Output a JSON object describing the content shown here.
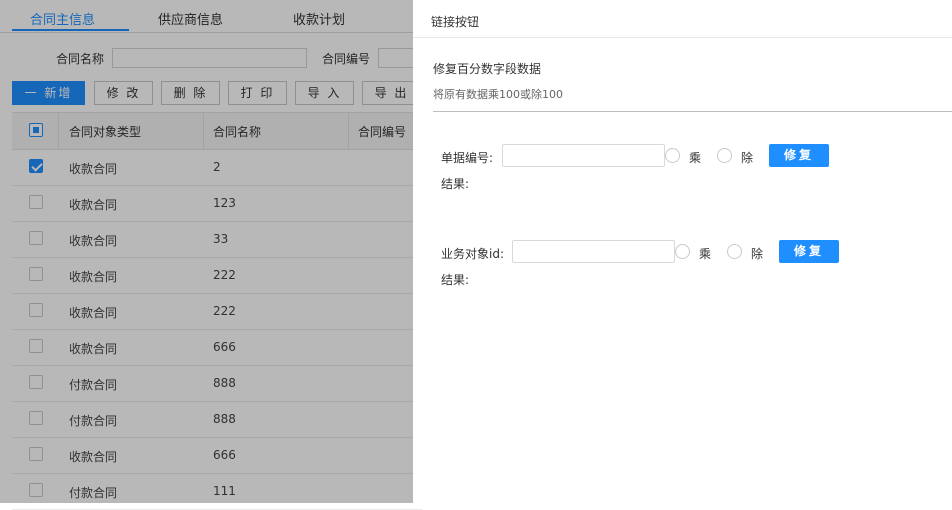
{
  "background": {
    "tabs": [
      "合同主信息",
      "供应商信息",
      "收款计划"
    ],
    "filters": {
      "contract_name_label": "合同名称",
      "contract_no_label": "合同编号"
    },
    "toolbar": {
      "add": "一 新增",
      "edit": "修 改",
      "delete": "删 除",
      "print": "打 印",
      "import": "导 入",
      "export": "导 出"
    },
    "table": {
      "headers": [
        "合同对象类型",
        "合同名称",
        "合同编号"
      ],
      "rows": [
        {
          "type": "收款合同",
          "name": "2",
          "checked": true
        },
        {
          "type": "收款合同",
          "name": "123",
          "checked": false
        },
        {
          "type": "收款合同",
          "name": "33",
          "checked": false
        },
        {
          "type": "收款合同",
          "name": "222",
          "checked": false
        },
        {
          "type": "收款合同",
          "name": "222",
          "checked": false
        },
        {
          "type": "收款合同",
          "name": "666",
          "checked": false
        },
        {
          "type": "付款合同",
          "name": "888",
          "checked": false
        },
        {
          "type": "付款合同",
          "name": "888",
          "checked": false
        },
        {
          "type": "收款合同",
          "name": "666",
          "checked": false
        },
        {
          "type": "付款合同",
          "name": "111",
          "checked": false
        }
      ]
    }
  },
  "drawer": {
    "title": "链接按钮",
    "section_title": "修复百分数字段数据",
    "section_desc": "将原有数据乘100或除100",
    "form1": {
      "label": "单据编号:",
      "value": "",
      "multiply": "乘",
      "divide": "除",
      "button": "修复",
      "result_label": "结果:"
    },
    "form2": {
      "label": "业务对象id:",
      "value": "",
      "multiply": "乘",
      "divide": "除",
      "button": "修复",
      "result_label": "结果:"
    }
  },
  "colors": {
    "accent": "#1f8fff",
    "overlay": "rgba(0,0,0,0.28)"
  }
}
